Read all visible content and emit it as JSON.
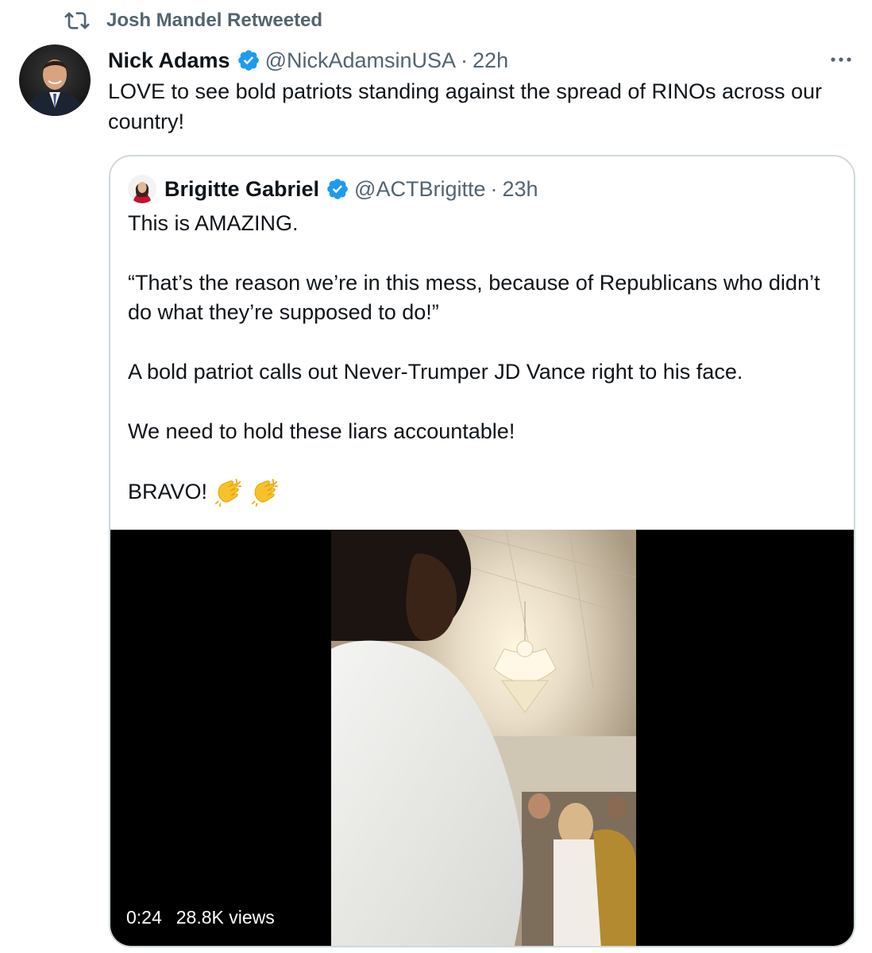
{
  "retweet_banner": {
    "icon": "retweet-icon",
    "label": "Josh Mandel Retweeted"
  },
  "tweet": {
    "author_name": "Nick Adams",
    "verified": true,
    "handle": "@NickAdamsinUSA",
    "separator": "·",
    "time": "22h",
    "more_icon": "more-icon",
    "text": "LOVE to see bold patriots standing against the spread of RINOs across our country!"
  },
  "quoted_tweet": {
    "author_name": "Brigitte Gabriel",
    "verified": true,
    "handle": "@ACTBrigitte",
    "separator": "·",
    "time": "23h",
    "paragraphs": [
      "This is AMAZING.",
      "“That’s the reason we’re in this mess, because of Republicans who didn’t do what they’re supposed to do!”",
      "A bold patriot calls out Never-Trumper JD Vance right to his face.",
      "We need to hold these liars accountable!",
      "BRAVO!"
    ],
    "emoji": [
      "clapping-hands-icon",
      "clapping-hands-icon"
    ],
    "video": {
      "duration": "0:24",
      "views": "28.8K views"
    }
  },
  "colors": {
    "text": "#0f1419",
    "secondary": "#536471",
    "verified": "#1d9bf0",
    "border": "#cfd9de"
  }
}
